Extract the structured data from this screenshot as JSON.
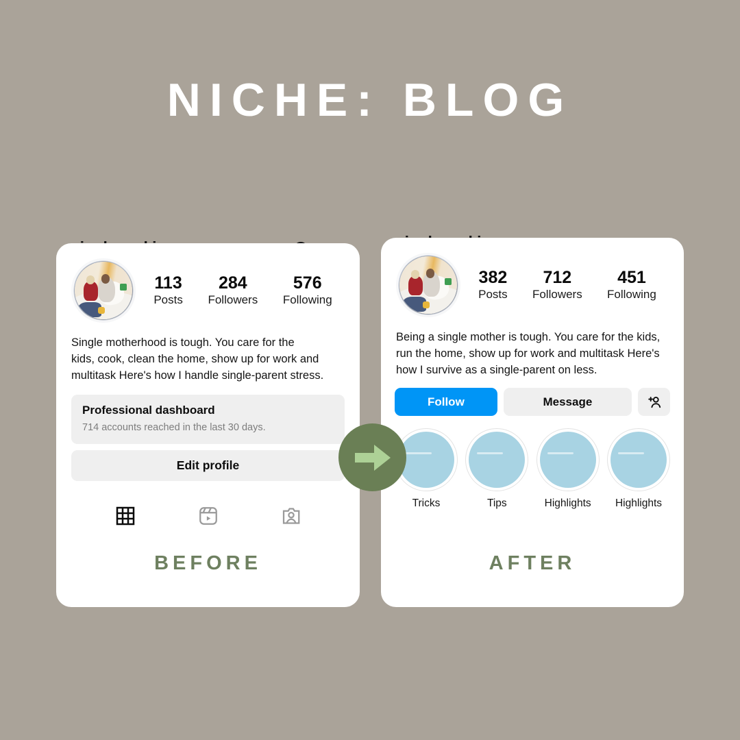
{
  "headline": "NICHE: BLOG",
  "colors": {
    "background": "#AAA399",
    "card": "#FFFFFF",
    "accent_green": "#6A7F55",
    "arrow_green": "#ADD196",
    "caption_green": "#6E8060",
    "follow_blue": "#0095F6",
    "button_gray": "#EFEFEF",
    "highlight_blue": "#A8D3E3"
  },
  "before": {
    "caption": "BEFORE",
    "username": "singleworkingmoms",
    "header_icons": [
      "plus-circle-icon",
      "hamburger-menu-icon"
    ],
    "stats": [
      {
        "value": "113",
        "label": "Posts"
      },
      {
        "value": "284",
        "label": "Followers"
      },
      {
        "value": "576",
        "label": "Following"
      }
    ],
    "bio_lines": [
      "Single motherhood is tough. You care for the",
      "kids, cook, clean the home, show up for work and",
      "multitask  Here's how I handle single-parent stress."
    ],
    "dashboard": {
      "title": "Professional dashboard",
      "subtitle": "714 accounts reached in the last 30 days."
    },
    "edit_profile_label": "Edit profile",
    "tabs": [
      {
        "icon": "grid-icon",
        "active": true
      },
      {
        "icon": "reels-icon",
        "active": false
      },
      {
        "icon": "tagged-icon",
        "active": false
      }
    ]
  },
  "after": {
    "caption": "AFTER",
    "username": "singleworkingmoms",
    "stats": [
      {
        "value": "382",
        "label": "Posts"
      },
      {
        "value": "712",
        "label": "Followers"
      },
      {
        "value": "451",
        "label": "Following"
      }
    ],
    "bio_lines": [
      "Being a single mother is tough. You care for the kids,",
      "run the home, show up for work and multitask  Here's",
      "how I survive as a single-parent on less."
    ],
    "actions": {
      "follow_label": "Follow",
      "message_label": "Message",
      "add_user_icon": "add-person-icon"
    },
    "highlights": [
      {
        "label": "Tricks"
      },
      {
        "label": "Tips"
      },
      {
        "label": "Highlights"
      },
      {
        "label": "Highlights"
      }
    ]
  },
  "arrow": {
    "icon": "right-arrow-icon"
  }
}
